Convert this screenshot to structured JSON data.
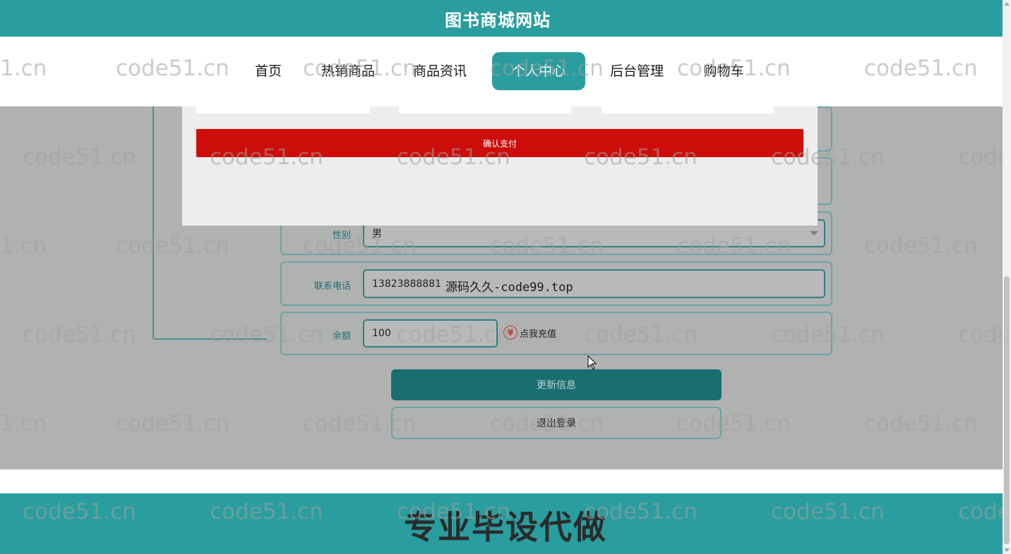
{
  "header": {
    "title": "图书商城网站"
  },
  "nav": {
    "items": [
      {
        "label": "首页"
      },
      {
        "label": "热销商品"
      },
      {
        "label": "商品资讯"
      },
      {
        "label": "个人中心"
      },
      {
        "label": "后台管理"
      },
      {
        "label": "购物车"
      }
    ],
    "active": "个人中心"
  },
  "modal": {
    "confirm_pay_label": "确认支付"
  },
  "form": {
    "gender": {
      "label": "性别",
      "value": "男"
    },
    "phone": {
      "label": "联系电话",
      "value": "13823888881"
    },
    "balance": {
      "label": "余额",
      "value": "100"
    },
    "recharge_label": "点我充值",
    "update_label": "更新信息",
    "logout_label": "退出登录"
  },
  "overlay_text": "源码久久-code99.top",
  "watermark": {
    "text": "code51.cn",
    "partial": "1.cn",
    "edge": "code"
  },
  "footer": {
    "text": "专业毕设代做"
  },
  "icons": {
    "recharge": "yuan-icon",
    "yuan_glyph": "¥",
    "cursor": "mouse-cursor-icon"
  },
  "colors": {
    "brand": "#2a9d9e",
    "pay": "#cc0d0a",
    "update": "#1b6e6f"
  }
}
